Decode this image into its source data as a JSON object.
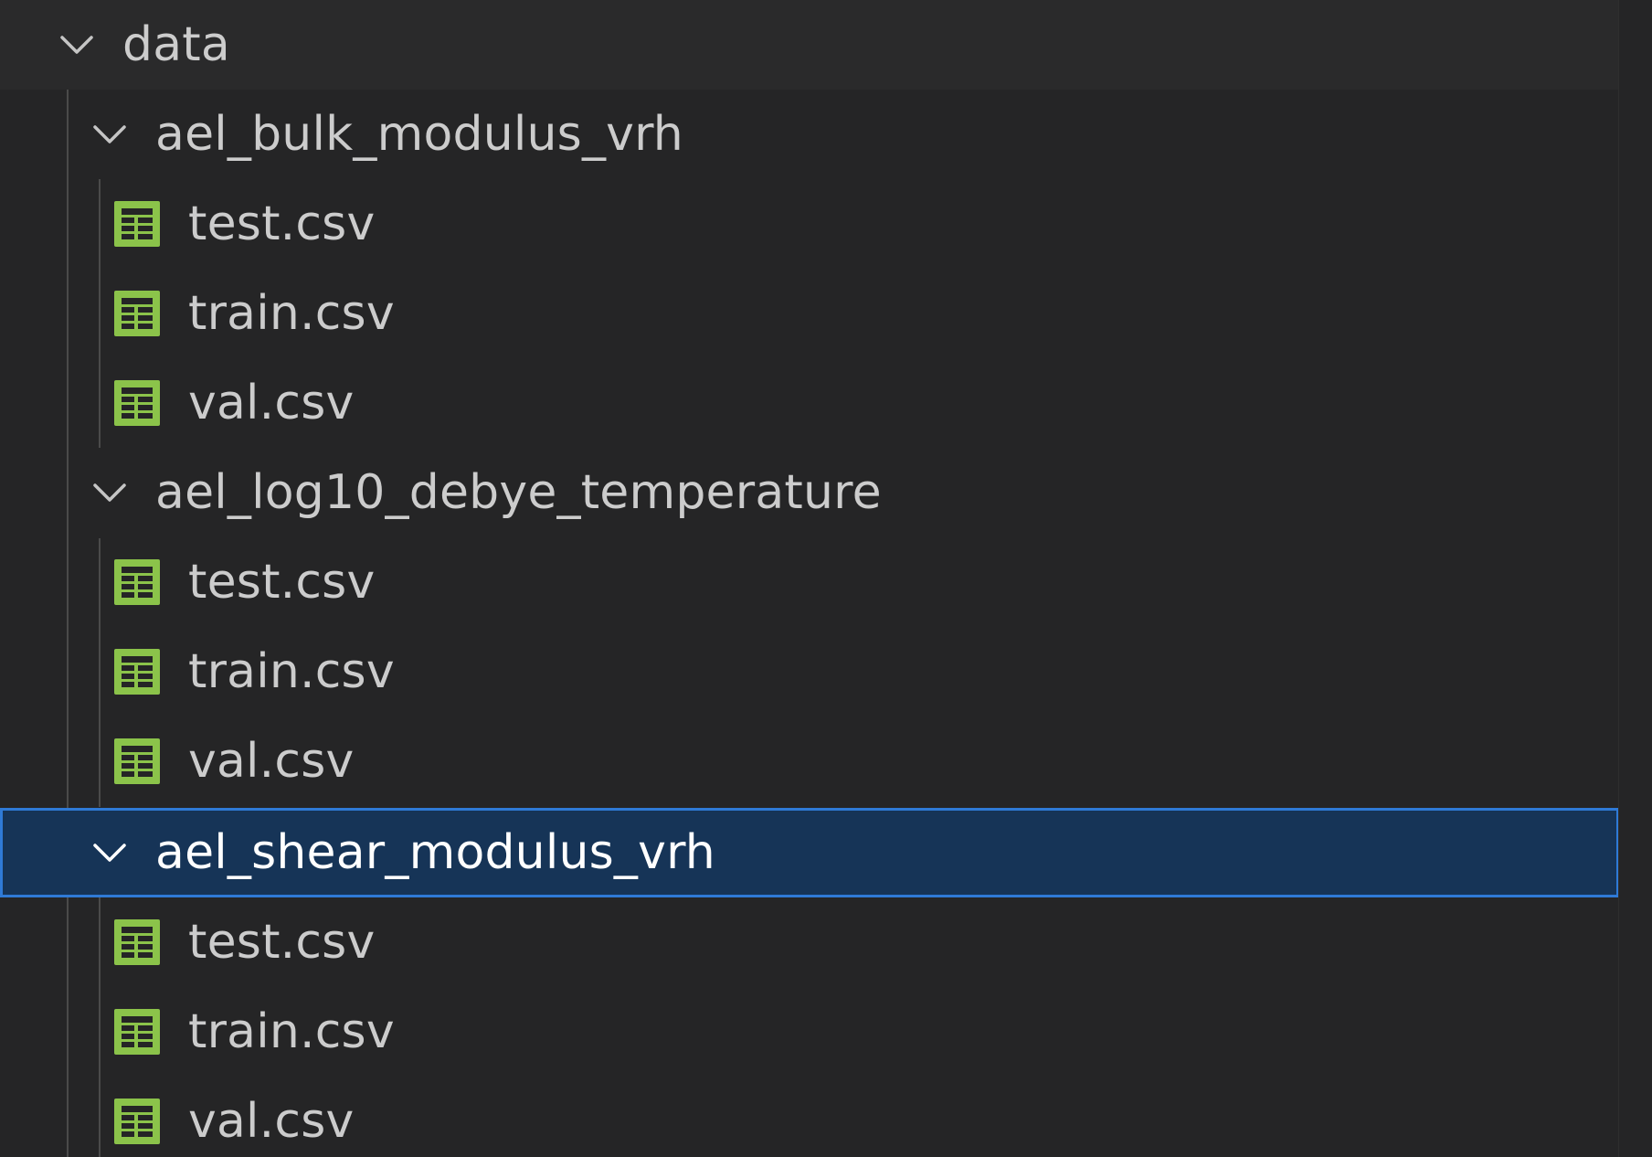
{
  "tree": {
    "root": {
      "label": "data",
      "icon": "chevron-down-icon"
    },
    "folders": [
      {
        "label": "ael_bulk_modulus_vrh",
        "icon": "chevron-down-icon",
        "files": [
          {
            "label": "test.csv",
            "icon": "csv-table-icon"
          },
          {
            "label": "train.csv",
            "icon": "csv-table-icon"
          },
          {
            "label": "val.csv",
            "icon": "csv-table-icon"
          }
        ]
      },
      {
        "label": "ael_log10_debye_temperature",
        "icon": "chevron-down-icon",
        "files": [
          {
            "label": "test.csv",
            "icon": "csv-table-icon"
          },
          {
            "label": "train.csv",
            "icon": "csv-table-icon"
          },
          {
            "label": "val.csv",
            "icon": "csv-table-icon"
          }
        ]
      },
      {
        "label": "ael_shear_modulus_vrh",
        "icon": "chevron-down-icon",
        "selected": true,
        "files": [
          {
            "label": "test.csv",
            "icon": "csv-table-icon"
          },
          {
            "label": "train.csv",
            "icon": "csv-table-icon"
          },
          {
            "label": "val.csv",
            "icon": "csv-table-icon"
          }
        ]
      }
    ]
  },
  "colors": {
    "background": "#252526",
    "text": "#cccccc",
    "selection_bg": "#163457",
    "selection_border": "#2f7ad6",
    "csv_icon": "#8bc34a"
  }
}
